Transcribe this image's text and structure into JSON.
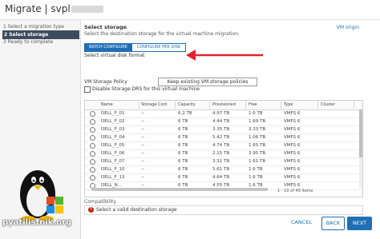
{
  "window": {
    "title": "Migrate | svpl"
  },
  "wizard": {
    "steps": [
      {
        "label": "1 Select a migration type",
        "state": "done"
      },
      {
        "label": "2 Select storage",
        "state": "active"
      },
      {
        "label": "3 Ready to complete",
        "state": "pending"
      }
    ]
  },
  "page": {
    "heading": "Select storage",
    "description": "Select the destination storage for the virtual machine migration.",
    "vm_origin_link": "VM origin",
    "tabs": [
      {
        "label": "BATCH CONFIGURE",
        "selected": true
      },
      {
        "label": "CONFIGURE PER DISK",
        "selected": false
      }
    ],
    "disk_format_label": "Select virtual disk format",
    "vm_storage_policy_label": "VM Storage Policy",
    "vm_storage_policy_value": "Keep existing VM storage policies",
    "disable_drs_label": "Disable Storage DRS for this virtual machine",
    "disable_drs_checked": false
  },
  "table": {
    "columns": [
      "Name",
      "Storage Com",
      "Capacity",
      "Provisioned",
      "Free",
      "Type",
      "Cluster"
    ],
    "rows": [
      [
        "DELL_F_01",
        "--",
        "6.2 TB",
        "4.97 TB",
        "1.6 TB",
        "VMFS 6",
        ""
      ],
      [
        "DELL_F_02",
        "--",
        "6 TB",
        "4.44 TB",
        "1.69 TB",
        "VMFS 6",
        ""
      ],
      [
        "DELL_F_03",
        "--",
        "6 TB",
        "3.35 TB",
        "3.33 TB",
        "VMFS 6",
        ""
      ],
      [
        "DELL_F_04",
        "--",
        "6 TB",
        "5.42 TB",
        "1.06 TB",
        "VMFS 6",
        ""
      ],
      [
        "DELL_F_05",
        "--",
        "6 TB",
        "4.74 TB",
        "1.65 TB",
        "VMFS 6",
        ""
      ],
      [
        "DELL_F_06",
        "--",
        "6 TB",
        "2.15 TB",
        "3.95 TB",
        "VMFS 6",
        ""
      ],
      [
        "DELL_F_07",
        "--",
        "6 TB",
        "3.31 TB",
        "1.61 TB",
        "VMFS 6",
        ""
      ],
      [
        "DELL_F_10",
        "--",
        "6 TB",
        "5.61 TB",
        "1.6 TB",
        "VMFS 6",
        ""
      ],
      [
        "DELL_F_13",
        "--",
        "6 TB",
        "4.64 TB",
        "1.6 TB",
        "VMFS 6",
        ""
      ],
      [
        "DELL_N...",
        "--",
        "6 TB",
        "4.55 TB",
        "1.6 TB",
        "VMFS 6",
        ""
      ]
    ],
    "pagination": "1 - 10 of 49 items"
  },
  "compatibility": {
    "label": "Compatibility",
    "message": "Select a valid destination storage"
  },
  "buttons": {
    "cancel": "CANCEL",
    "back": "BACK",
    "next": "NEXT"
  },
  "watermark": {
    "text": "pyatilistnik.org"
  },
  "colors": {
    "accent": "#1e6fb4",
    "step_active": "#3d4c5c",
    "error": "#c92100",
    "arrow": "#e3232f"
  }
}
